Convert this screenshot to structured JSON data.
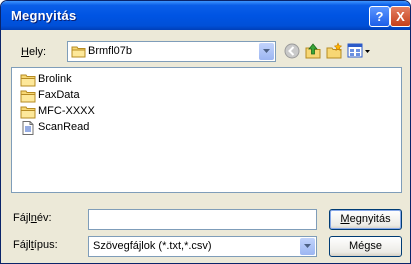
{
  "window": {
    "title": "Megnyitás"
  },
  "title_buttons": {
    "help": "?",
    "close": "X"
  },
  "location": {
    "label_before": "",
    "label_hot": "H",
    "label_after": "ely:",
    "folder": "Brmfl07b"
  },
  "toolbar": {
    "icons": [
      "back-icon",
      "up-folder-icon",
      "new-folder-icon",
      "view-menu-icon"
    ]
  },
  "files": [
    {
      "name": "Brolink",
      "kind": "folder"
    },
    {
      "name": "FaxData",
      "kind": "folder"
    },
    {
      "name": "MFC-XXXX",
      "kind": "folder"
    },
    {
      "name": "ScanRead",
      "kind": "file"
    }
  ],
  "filename": {
    "label_before": "Fájl",
    "label_hot": "n",
    "label_after": "év:",
    "value": ""
  },
  "filetype": {
    "label_before": "Fájl",
    "label_hot": "t",
    "label_after": "ípus:",
    "value": "Szövegfájlok (*.txt,*.csv)"
  },
  "buttons": {
    "open_hot": "M",
    "open_rest": "egnyitás",
    "cancel": "Mégse"
  }
}
